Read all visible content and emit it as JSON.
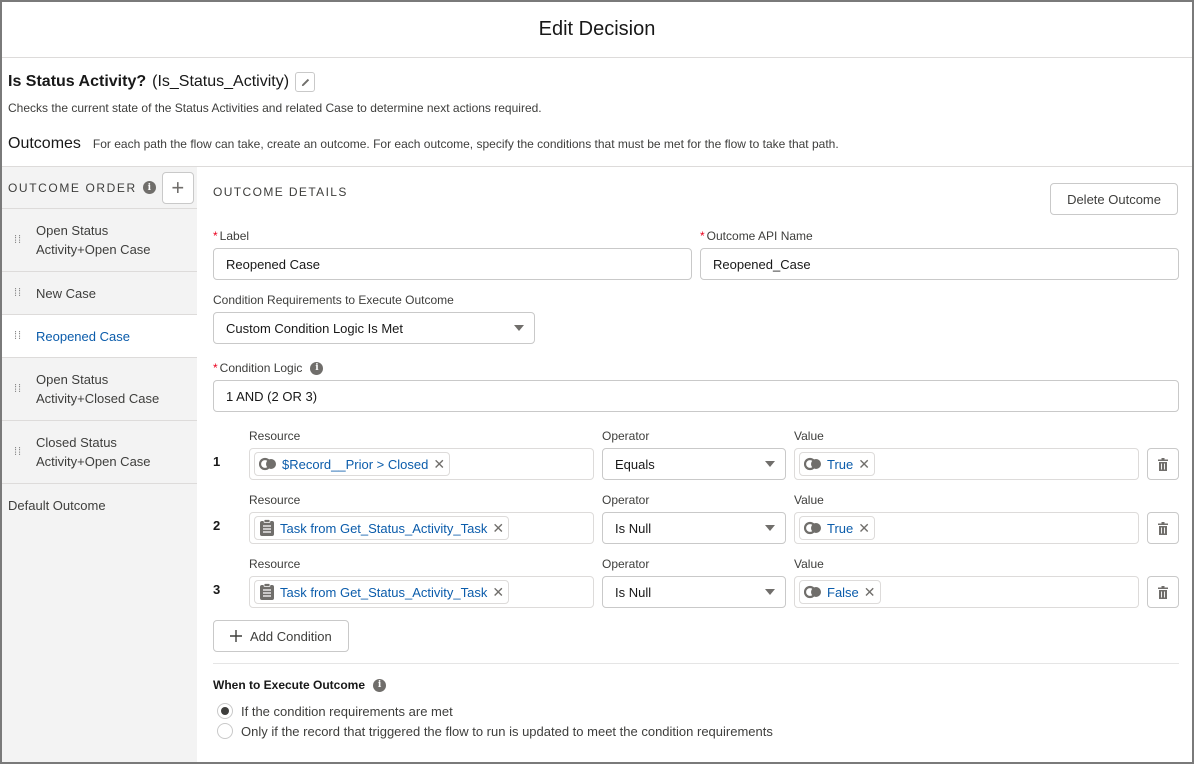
{
  "modal": {
    "title": "Edit Decision"
  },
  "element": {
    "label": "Is Status Activity?",
    "api_name": "(Is_Status_Activity)",
    "description": "Checks the current state of the Status Activities and related Case to determine next actions required."
  },
  "outcomes_section": {
    "heading": "Outcomes",
    "help": "For each path the flow can take, create an outcome. For each outcome, specify the conditions that must be met for the flow to take that path."
  },
  "sidebar": {
    "header": "OUTCOME ORDER",
    "add_symbol": "+",
    "items": [
      {
        "line1": "Open Status",
        "line2": "Activity+Open Case",
        "active": false
      },
      {
        "line1": "New Case",
        "line2": "",
        "active": false
      },
      {
        "line1": "Reopened Case",
        "line2": "",
        "active": true
      },
      {
        "line1": "Open Status",
        "line2": "Activity+Closed Case",
        "active": false
      },
      {
        "line1": "Closed Status",
        "line2": "Activity+Open Case",
        "active": false
      }
    ],
    "default_outcome": "Default Outcome"
  },
  "details": {
    "section_title": "OUTCOME DETAILS",
    "delete_label": "Delete Outcome",
    "label_field": {
      "label": "Label",
      "value": "Reopened Case",
      "required": "*"
    },
    "api_field": {
      "label": "Outcome API Name",
      "value": "Reopened_Case",
      "required": "*"
    },
    "requirements": {
      "label": "Condition Requirements to Execute Outcome",
      "value": "Custom Condition Logic Is Met"
    },
    "logic": {
      "label": "Condition Logic",
      "value": "1 AND (2 OR 3)",
      "required": "*"
    },
    "column_labels": {
      "resource": "Resource",
      "operator": "Operator",
      "value": "Value"
    },
    "conditions": [
      {
        "num": "1",
        "resource": "$Record__Prior > Closed",
        "resource_icon": "boolean-icon",
        "operator": "Equals",
        "value": "True"
      },
      {
        "num": "2",
        "resource": "Task from Get_Status_Activity_Task",
        "resource_icon": "record-icon",
        "operator": "Is Null",
        "value": "True"
      },
      {
        "num": "3",
        "resource": "Task from Get_Status_Activity_Task",
        "resource_icon": "record-icon",
        "operator": "Is Null",
        "value": "False"
      }
    ],
    "add_condition_label": "Add Condition",
    "when": {
      "title": "When to Execute Outcome",
      "options": [
        {
          "label": "If the condition requirements are met",
          "checked": true
        },
        {
          "label": "Only if the record that triggered the flow to run is updated to meet the condition requirements",
          "checked": false
        }
      ]
    }
  },
  "colors": {
    "link": "#0b5cab",
    "required": "#ea001e",
    "sidebar_bg": "#f3f3f3"
  }
}
